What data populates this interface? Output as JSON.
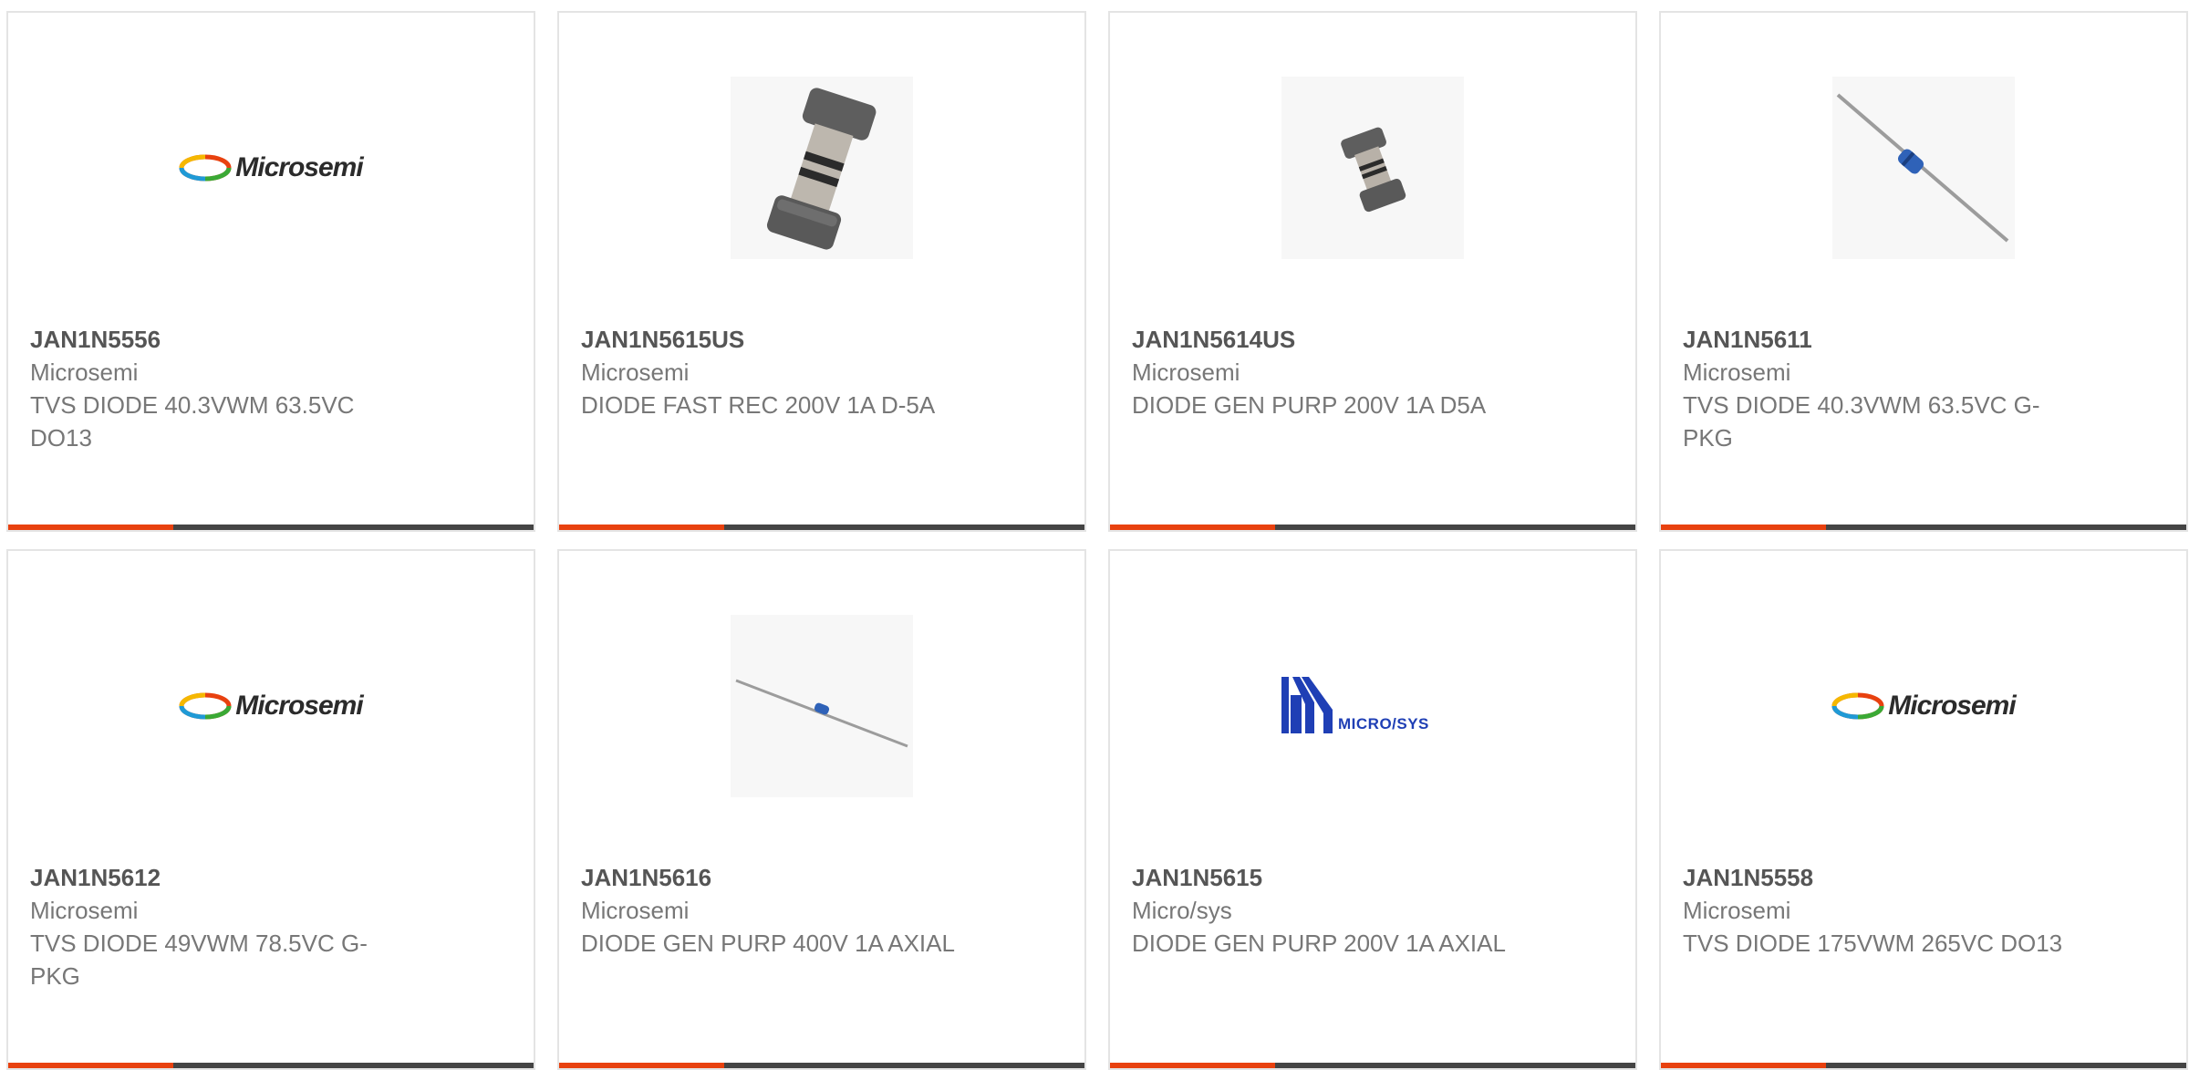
{
  "products": [
    {
      "part": "JAN1N5556",
      "mfr": "Microsemi",
      "desc": "TVS DIODE 40.3VWM 63.5VC DO13",
      "image": "microsemi-logo"
    },
    {
      "part": "JAN1N5615US",
      "mfr": "Microsemi",
      "desc": "DIODE FAST REC 200V 1A D-5A",
      "image": "smd-diode-photo-large"
    },
    {
      "part": "JAN1N5614US",
      "mfr": "Microsemi",
      "desc": "DIODE GEN PURP 200V 1A D5A",
      "image": "smd-diode-photo-small"
    },
    {
      "part": "JAN1N5611",
      "mfr": "Microsemi",
      "desc": "TVS DIODE 40.3VWM 63.5VC G-PKG",
      "image": "axial-diode-photo-steep"
    },
    {
      "part": "JAN1N5612",
      "mfr": "Microsemi",
      "desc": "TVS DIODE 49VWM 78.5VC G-PKG",
      "image": "microsemi-logo"
    },
    {
      "part": "JAN1N5616",
      "mfr": "Microsemi",
      "desc": "DIODE GEN PURP 400V 1A AXIAL",
      "image": "axial-diode-photo-shallow"
    },
    {
      "part": "JAN1N5615",
      "mfr": "Micro/sys",
      "desc": "DIODE GEN PURP 200V 1A AXIAL",
      "image": "microsys-logo"
    },
    {
      "part": "JAN1N5558",
      "mfr": "Microsemi",
      "desc": "TVS DIODE 175VWM 265VC DO13",
      "image": "microsemi-logo"
    }
  ],
  "logos": {
    "microsemi_text": "Microsemi",
    "microsys_text": "MICRO/SYS"
  },
  "colors": {
    "accent": "#e8410f",
    "bar": "#444444",
    "card_border": "#e4e4e4",
    "part_text": "#555555",
    "meta_text": "#777777",
    "microsys_blue": "#1f3fb5"
  }
}
